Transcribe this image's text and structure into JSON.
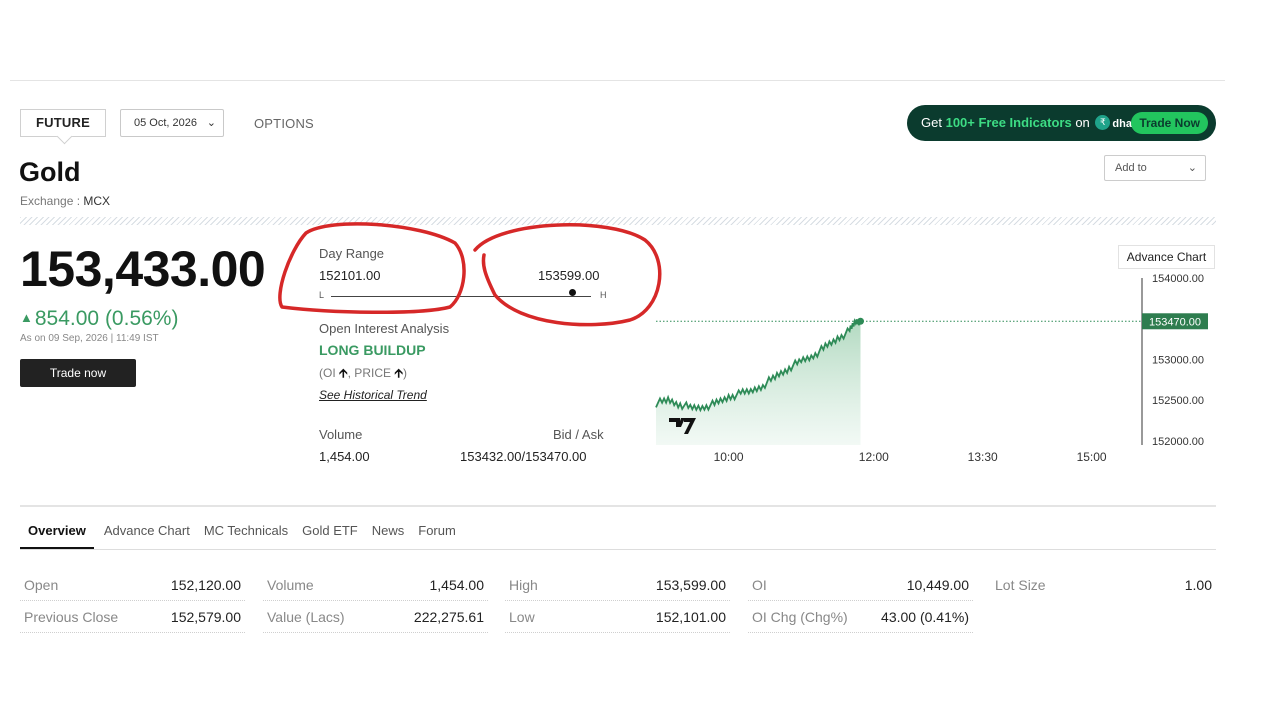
{
  "header": {
    "future_tab": "FUTURE",
    "expiry_value": "05 Oct, 2026",
    "options_tab": "OPTIONS",
    "promo": {
      "prefix": "Get",
      "highlight": "100+ Free Indicators",
      "on": "on",
      "brand": "dhan",
      "button": "Trade Now"
    },
    "add_to": "Add to"
  },
  "instrument": {
    "name": "Gold",
    "exchange_label": "Exchange :",
    "exchange": "MCX",
    "price": "153,433.00",
    "change": "854.00 (0.56%)",
    "as_on": "As on 09 Sep, 2026 | 11:49 IST",
    "trade_button": "Trade now"
  },
  "day_range": {
    "label": "Day Range",
    "low": "152101.00",
    "high": "153599.00",
    "low_tag": "L",
    "high_tag": "H",
    "current_fraction": 0.93
  },
  "oi_analysis": {
    "label": "Open Interest Analysis",
    "status": "LONG BUILDUP",
    "detail_oi": "(OI",
    "detail_price": ", PRICE",
    "detail_close": ")",
    "link": "See Historical Trend"
  },
  "volume": {
    "label": "Volume",
    "value": "1,454.00"
  },
  "bid_ask": {
    "label": "Bid / Ask",
    "value": "153432.00/153470.00"
  },
  "advance_chart_button": "Advance Chart",
  "chart_data": {
    "type": "area",
    "x_ticks": [
      "10:00",
      "12:00",
      "13:30",
      "15:00"
    ],
    "y_ticks": [
      "154000.00",
      "153500.00",
      "153000.00",
      "152500.00",
      "152000.00"
    ],
    "last_price_label": "153470.00",
    "ylim": [
      151950,
      154100
    ],
    "series": [
      {
        "x": [
          "09:00",
          "09:10",
          "09:20",
          "09:30",
          "09:40",
          "09:50",
          "10:00",
          "10:10",
          "10:20",
          "10:30",
          "10:40",
          "10:50",
          "11:00",
          "11:10",
          "11:20",
          "11:30",
          "11:40",
          "11:45",
          "11:49"
        ],
        "values": [
          152460,
          152500,
          152450,
          152400,
          152420,
          152460,
          152540,
          152580,
          152620,
          152700,
          152800,
          152900,
          152980,
          153050,
          153150,
          153260,
          153350,
          153470,
          153470
        ]
      }
    ],
    "colors": {
      "line": "#2e8b57",
      "area": "#cfe8d8"
    }
  },
  "tabs": [
    "Overview",
    "Advance Chart",
    "MC Technicals",
    "Gold ETF",
    "News",
    "Forum"
  ],
  "stats": [
    [
      {
        "k": "Open",
        "v": "152,120.00"
      },
      {
        "k": "Volume",
        "v": "1,454.00"
      },
      {
        "k": "High",
        "v": "153,599.00"
      },
      {
        "k": "OI",
        "v": "10,449.00"
      },
      {
        "k": "Lot Size",
        "v": "1.00"
      }
    ],
    [
      {
        "k": "Previous Close",
        "v": "152,579.00"
      },
      {
        "k": "Value (Lacs)",
        "v": "222,275.61"
      },
      {
        "k": "Low",
        "v": "152,101.00"
      },
      {
        "k": "OI Chg (Chg%)",
        "v": "43.00 (0.41%)"
      }
    ]
  ]
}
